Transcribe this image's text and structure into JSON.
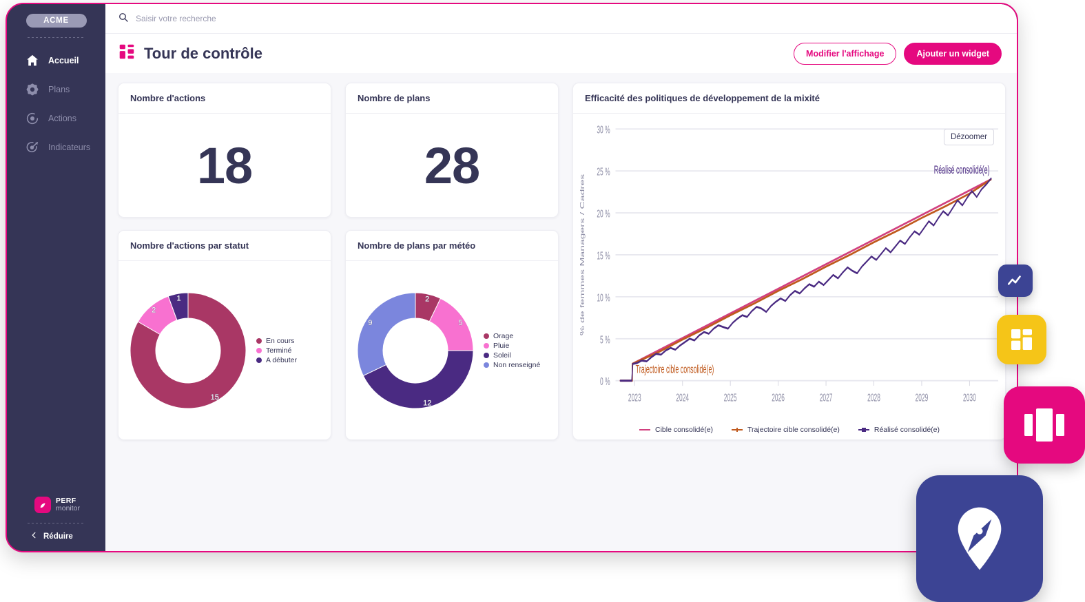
{
  "window": {
    "border_color": "#e5097f",
    "sidebar_bg": "#353556",
    "accent": "#e5097f"
  },
  "sidebar": {
    "brand": "ACME",
    "items": [
      {
        "label": "Accueil",
        "icon": "home-icon",
        "active": true
      },
      {
        "label": "Plans",
        "icon": "gear-icon",
        "active": false
      },
      {
        "label": "Actions",
        "icon": "target-dot-icon",
        "active": false
      },
      {
        "label": "Indicateurs",
        "icon": "dart-target-icon",
        "active": false
      }
    ],
    "product_logo_line1": "PERF",
    "product_logo_line2": "monitor",
    "collapse_label": "Réduire",
    "collapse_icon": "chevron-left-icon"
  },
  "search": {
    "placeholder": "Saisir votre recherche",
    "value": "",
    "icon": "search-icon"
  },
  "header": {
    "title": "Tour de contrôle",
    "title_icon": "dashboard-grid-icon",
    "edit_button": "Modifier l'affichage",
    "add_button": "Ajouter un widget"
  },
  "cards": {
    "actions_count": {
      "title": "Nombre d'actions",
      "value": "18"
    },
    "plans_count": {
      "title": "Nombre de plans",
      "value": "28"
    },
    "actions_by_status": {
      "title": "Nombre d'actions par statut"
    },
    "plans_by_weather": {
      "title": "Nombre de plans par météo"
    },
    "mixity": {
      "title": "Efficacité des politiques de développement de la mixité",
      "zoom_out_button": "Dézoomer"
    }
  },
  "chart_data": [
    {
      "type": "pie",
      "title": "Nombre d'actions par statut",
      "donut": true,
      "labels": [
        "En cours",
        "Terminé",
        "A débuter"
      ],
      "values": [
        15,
        2,
        1
      ],
      "colors": [
        "#a93765",
        "#f871d0",
        "#4a2a82"
      ],
      "legend_position": "right",
      "total": 18
    },
    {
      "type": "pie",
      "title": "Nombre de plans par météo",
      "donut": true,
      "labels": [
        "Orage",
        "Pluie",
        "Soleil",
        "Non renseigné"
      ],
      "values": [
        2,
        5,
        12,
        9
      ],
      "colors": [
        "#a93765",
        "#f871d0",
        "#4a2a82",
        "#7b86dd"
      ],
      "legend_position": "right",
      "total": 28
    },
    {
      "type": "line",
      "title": "Efficacité des politiques de développement de la mixité",
      "xlabel": "",
      "ylabel": "% de femmes Managers / Cadres",
      "x_ticks": [
        "2023",
        "2024",
        "2025",
        "2026",
        "2027",
        "2028",
        "2029",
        "2030"
      ],
      "y_ticks": [
        "0 %",
        "5 %",
        "10 %",
        "15 %",
        "20 %",
        "25 %",
        "30 %"
      ],
      "ylim": [
        0,
        30
      ],
      "xlim": [
        2022.6,
        2030.6
      ],
      "grid": true,
      "legend_position": "bottom",
      "annotations": [
        {
          "text": "Trajectoire cible consolidé(e)",
          "color": "#c05a1e"
        },
        {
          "text": "Réalisé consolidé(e)",
          "color": "#4a2a82"
        }
      ],
      "series": [
        {
          "name": "Cible consolidé(e)",
          "color": "#d1407f",
          "marker": "none",
          "x": [
            2022.7,
            2022.95,
            2022.95,
            2030.45
          ],
          "values": [
            0,
            0,
            2.0,
            24.0
          ]
        },
        {
          "name": "Trajectoire cible consolidé(e)",
          "color": "#c05a1e",
          "marker": "cross",
          "x": [
            2022.7,
            2022.95,
            2022.95,
            2023.5,
            2024,
            2024.5,
            2025,
            2025.5,
            2026,
            2026.5,
            2027,
            2027.5,
            2028,
            2028.5,
            2029,
            2029.5,
            2030,
            2030.45
          ],
          "values": [
            0,
            0,
            2.0,
            3.4,
            4.9,
            6.3,
            7.8,
            9.2,
            10.7,
            12.1,
            13.6,
            15.0,
            16.5,
            17.9,
            19.4,
            20.8,
            22.3,
            24.0
          ]
        },
        {
          "name": "Réalisé consolidé(e)",
          "color": "#4a2a82",
          "marker": "square",
          "x": [
            2022.7,
            2022.78,
            2022.86,
            2022.94,
            2022.96,
            2023.05,
            2023.15,
            2023.25,
            2023.35,
            2023.45,
            2023.55,
            2023.65,
            2023.75,
            2023.85,
            2023.95,
            2024.05,
            2024.15,
            2024.25,
            2024.35,
            2024.45,
            2024.55,
            2024.65,
            2024.75,
            2024.85,
            2024.95,
            2025.05,
            2025.15,
            2025.25,
            2025.35,
            2025.45,
            2025.55,
            2025.65,
            2025.75,
            2025.85,
            2025.95,
            2026.05,
            2026.15,
            2026.25,
            2026.35,
            2026.45,
            2026.55,
            2026.65,
            2026.75,
            2026.85,
            2026.95,
            2027.05,
            2027.15,
            2027.25,
            2027.35,
            2027.45,
            2027.55,
            2027.65,
            2027.75,
            2027.85,
            2027.95,
            2028.05,
            2028.15,
            2028.25,
            2028.35,
            2028.45,
            2028.55,
            2028.65,
            2028.75,
            2028.85,
            2028.95,
            2029.05,
            2029.15,
            2029.25,
            2029.35,
            2029.45,
            2029.55,
            2029.65,
            2029.75,
            2029.85,
            2029.95,
            2030.05,
            2030.15,
            2030.25,
            2030.35,
            2030.45
          ],
          "values": [
            0,
            0,
            0,
            0,
            2.0,
            2.1,
            2.4,
            2.3,
            2.8,
            3.2,
            3.1,
            3.6,
            3.9,
            3.7,
            4.2,
            4.6,
            5.0,
            4.8,
            5.4,
            5.8,
            5.6,
            6.2,
            6.6,
            6.4,
            6.2,
            6.9,
            7.4,
            7.8,
            7.6,
            8.3,
            8.8,
            8.6,
            8.2,
            8.9,
            9.4,
            9.8,
            9.5,
            10.2,
            10.7,
            10.4,
            11.0,
            11.5,
            11.2,
            11.8,
            11.4,
            12.0,
            12.6,
            12.2,
            12.9,
            13.5,
            13.1,
            12.8,
            13.6,
            14.2,
            14.8,
            14.4,
            15.1,
            15.8,
            15.3,
            16.0,
            16.7,
            16.3,
            17.1,
            17.8,
            17.4,
            18.2,
            19.0,
            18.5,
            19.4,
            20.2,
            19.7,
            20.6,
            21.5,
            20.9,
            21.8,
            22.6,
            21.9,
            22.8,
            23.4,
            24.1
          ]
        }
      ],
      "pie_value_labels": []
    }
  ],
  "floating_icons": [
    {
      "name": "line-chart-app-icon",
      "color": "#3c4494"
    },
    {
      "name": "dashboard-grid-app-icon",
      "color": "#f5c518"
    },
    {
      "name": "carousel-app-icon",
      "color": "#e5097f"
    },
    {
      "name": "map-pin-compass-app-icon",
      "color": "#3c4494"
    }
  ]
}
